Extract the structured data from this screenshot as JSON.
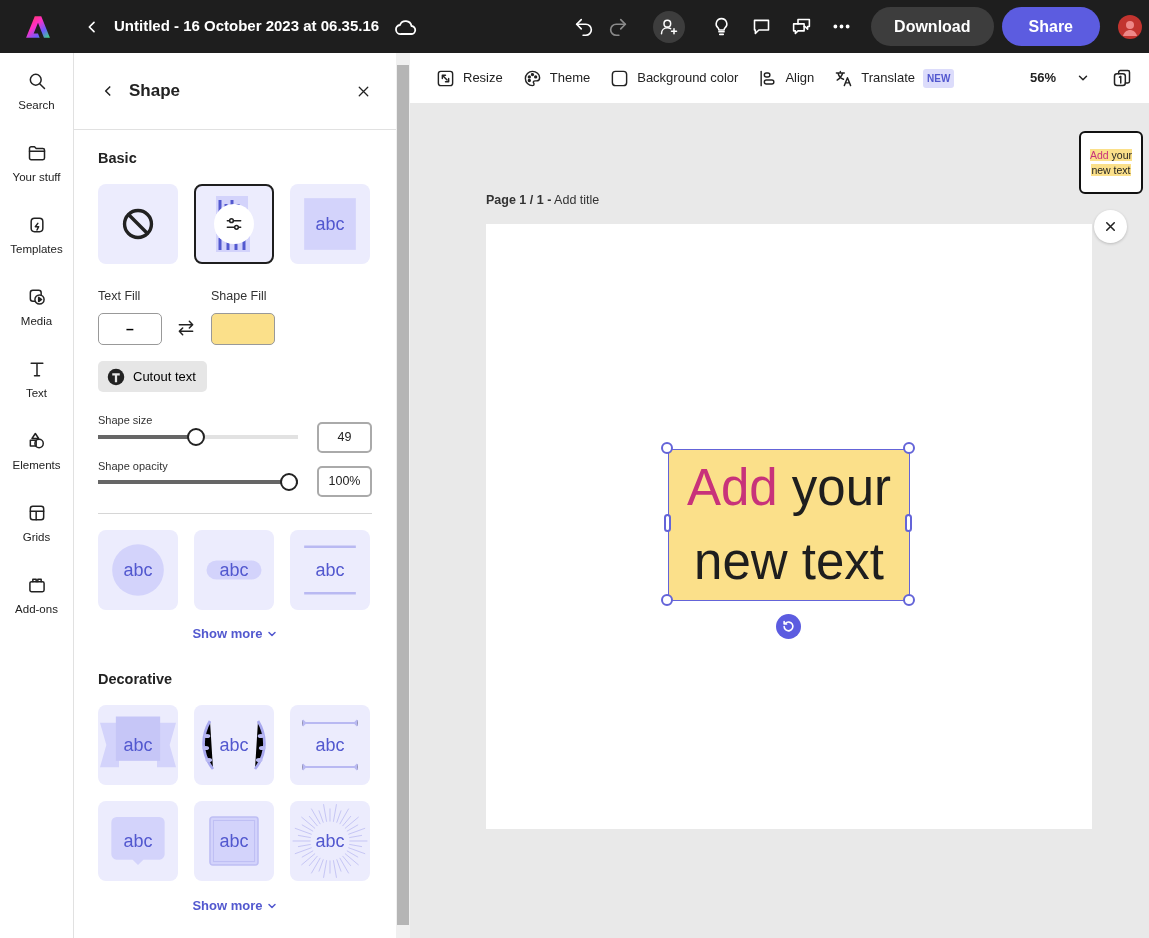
{
  "app_bar": {
    "title": "Untitled - 16 October 2023 at 06.35.16",
    "download": "Download",
    "share": "Share"
  },
  "rail": [
    {
      "label": "Search"
    },
    {
      "label": "Your stuff"
    },
    {
      "label": "Templates"
    },
    {
      "label": "Media"
    },
    {
      "label": "Text"
    },
    {
      "label": "Elements"
    },
    {
      "label": "Grids"
    },
    {
      "label": "Add-ons"
    }
  ],
  "panel": {
    "title": "Shape",
    "basic": {
      "heading": "Basic",
      "styles": [
        {
          "kind": "none",
          "selected": false
        },
        {
          "kind": "highlight",
          "selected": true
        },
        {
          "kind": "square",
          "label": "abc",
          "selected": false
        }
      ]
    },
    "text_fill": {
      "label": "Text Fill",
      "value": "–"
    },
    "shape_fill": {
      "label": "Shape Fill",
      "color": "#fbe08a"
    },
    "cutout": {
      "label": "Cutout text"
    },
    "sliders": [
      {
        "label": "Shape size",
        "level": 0.49,
        "reading": "49"
      },
      {
        "label": "Shape opacity",
        "level": 1,
        "reading": "100%"
      }
    ],
    "shapes": [
      {
        "kind": "circle",
        "label": "abc",
        "selected": false
      },
      {
        "kind": "pill",
        "label": "abc",
        "selected": false
      },
      {
        "kind": "lines",
        "label": "abc",
        "selected": false
      }
    ],
    "shapes_more": "Show more",
    "decorative": {
      "heading": "Decorative",
      "styles": [
        {
          "kind": "banner",
          "label": "abc",
          "selected": false
        },
        {
          "kind": "laurel",
          "label": "abc",
          "selected": false
        },
        {
          "kind": "arrows",
          "label": "abc",
          "selected": false
        },
        {
          "kind": "speech",
          "label": "abc",
          "selected": false
        },
        {
          "kind": "frame",
          "label": "abc",
          "selected": false
        },
        {
          "kind": "burst",
          "label": "abc",
          "selected": false
        }
      ],
      "more": "Show more"
    }
  },
  "toolbar": {
    "items": [
      {
        "label": "Resize"
      },
      {
        "label": "Theme"
      },
      {
        "label": "Background color"
      },
      {
        "label": "Align"
      },
      {
        "label": "Translate",
        "badge": "NEW"
      }
    ],
    "zoom": "56%"
  },
  "canvas": {
    "page_label": "**Page 1 / 1 -** Add title",
    "thumbnail": {
      "lines": [
        [
          {
            "text": "Add"
          },
          {
            "text": " your"
          }
        ],
        [
          {
            "text": "new text"
          }
        ]
      ]
    },
    "text_box": {
      "lines": [
        [
          {
            "text": "Add",
            "color": "#c8327a"
          },
          {
            "text": " your",
            "color": "#1e1e1e"
          }
        ],
        [
          {
            "text": "new text",
            "color": "#1e1e1e"
          }
        ]
      ],
      "selected": true
    }
  }
}
